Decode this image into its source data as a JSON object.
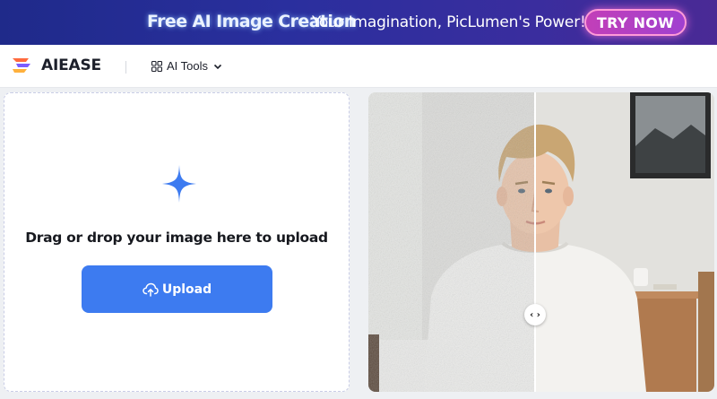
{
  "banner": {
    "title": "Free AI Image Creation",
    "tagline": "Your Imagination, PicLumen's Power!",
    "cta_label": "TRY NOW"
  },
  "navbar": {
    "brand": "AIEASE",
    "menu_label": "AI Tools",
    "menu_icon": "grid-icon",
    "menu_chevron": "chevron-down-icon"
  },
  "upload": {
    "icon": "plus-icon",
    "prompt": "Drag or drop your image here to upload",
    "button_label": "Upload",
    "button_icon": "cloud-upload-icon"
  },
  "comparison": {
    "handle_icon": "‹ ›",
    "split_fraction": 0.48
  },
  "colors": {
    "accent": "#3d7bf0",
    "banner_bg": "#2a2f9e",
    "cta_pink": "#c23fb8",
    "page_bg": "#eef0f3"
  }
}
